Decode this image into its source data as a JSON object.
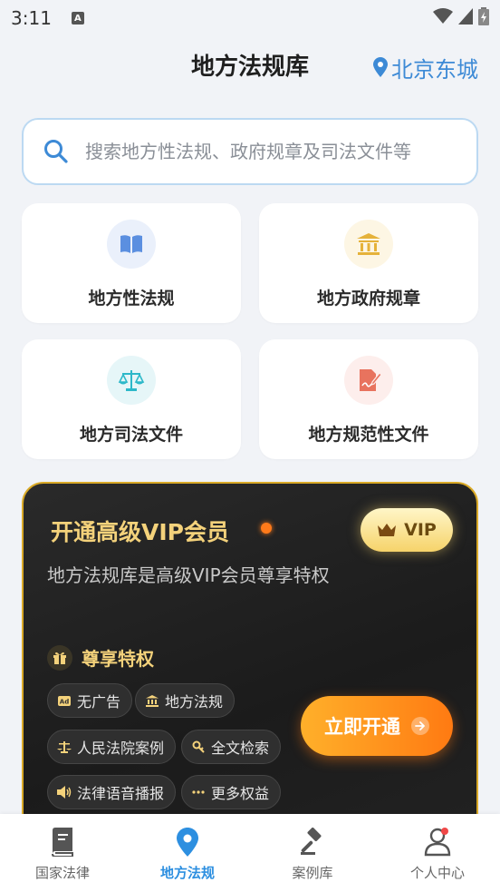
{
  "status_bar": {
    "time": "3:11",
    "notification_letter": "A"
  },
  "header": {
    "title": "地方法规库",
    "location": "北京东城"
  },
  "search": {
    "placeholder": "搜索地方性法规、政府规章及司法文件等"
  },
  "categories": [
    {
      "label": "地方性法规",
      "icon": "book-icon",
      "icon_bg": "#eaf0fb",
      "icon_color": "#5b8fe0"
    },
    {
      "label": "地方政府规章",
      "icon": "government-building-icon",
      "icon_bg": "#fdf6e4",
      "icon_color": "#e5b23a"
    },
    {
      "label": "地方司法文件",
      "icon": "scales-icon",
      "icon_bg": "#e6f6f8",
      "icon_color": "#2db8c9"
    },
    {
      "label": "地方规范性文件",
      "icon": "document-edit-icon",
      "icon_bg": "#fdeeec",
      "icon_color": "#e8735e"
    }
  ],
  "vip": {
    "title": "开通高级VIP会员",
    "badge": "VIP",
    "description": "地方法规库是高级VIP会员尊享特权",
    "privilege_heading": "尊享特权",
    "tags": [
      {
        "label": "无广告",
        "icon": "ad-icon"
      },
      {
        "label": "地方法规",
        "icon": "government-building-icon"
      },
      {
        "label": "人民法院案例",
        "icon": "scales-icon"
      },
      {
        "label": "全文检索",
        "icon": "key-search-icon"
      },
      {
        "label": "法律语音播报",
        "icon": "speaker-icon"
      },
      {
        "label": "更多权益",
        "icon": "more-dots-icon"
      }
    ],
    "open_button": "立即开通",
    "accent_gold": "#f4d27b",
    "accent_orange": "#ff7a12"
  },
  "bottom_nav": [
    {
      "label": "国家法律",
      "icon": "law-book-icon",
      "active": false
    },
    {
      "label": "地方法规",
      "icon": "location-pin-icon",
      "active": true
    },
    {
      "label": "案例库",
      "icon": "gavel-icon",
      "active": false
    },
    {
      "label": "个人中心",
      "icon": "user-icon",
      "active": false
    }
  ]
}
